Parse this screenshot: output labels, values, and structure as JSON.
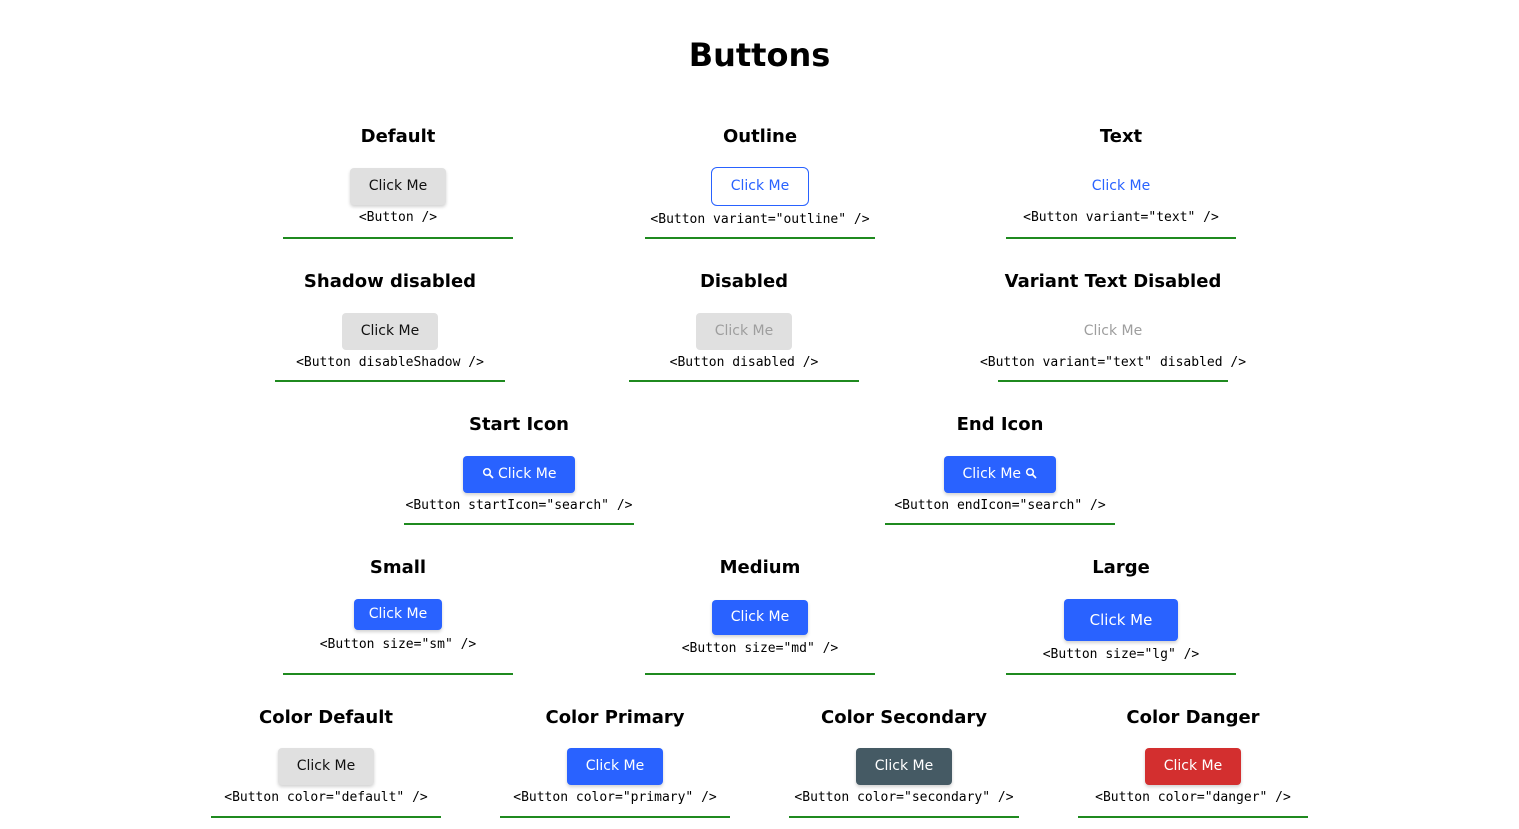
{
  "page": {
    "title": "Buttons"
  },
  "sections": {
    "default": {
      "title": "Default",
      "button_label": "Click Me",
      "code": "<Button />"
    },
    "outline": {
      "title": "Outline",
      "button_label": "Click Me",
      "code": "<Button variant=\"outline\" />"
    },
    "text": {
      "title": "Text",
      "button_label": "Click Me",
      "code": "<Button variant=\"text\" />"
    },
    "shadow_disabled": {
      "title": "Shadow disabled",
      "button_label": "Click Me",
      "code": "<Button disableShadow />"
    },
    "disabled": {
      "title": "Disabled",
      "button_label": "Click Me",
      "code": "<Button disabled />"
    },
    "variant_text_disabled": {
      "title": "Variant Text Disabled",
      "button_label": "Click Me",
      "code": "<Button variant=\"text\" disabled />"
    },
    "start_icon": {
      "title": "Start Icon",
      "button_label": "Click Me",
      "icon": "search-icon",
      "code": "<Button startIcon=\"search\" />"
    },
    "end_icon": {
      "title": "End Icon",
      "button_label": "Click Me",
      "icon": "search-icon",
      "code": "<Button endIcon=\"search\" />"
    },
    "small": {
      "title": "Small",
      "button_label": "Click Me",
      "code": "<Button size=\"sm\" />"
    },
    "medium": {
      "title": "Medium",
      "button_label": "Click Me",
      "code": "<Button size=\"md\" />"
    },
    "large": {
      "title": "Large",
      "button_label": "Click Me",
      "code": "<Button size=\"lg\" />"
    },
    "color_default": {
      "title": "Color Default",
      "button_label": "Click Me",
      "code": "<Button color=\"default\" />"
    },
    "color_primary": {
      "title": "Color Primary",
      "button_label": "Click Me",
      "code": "<Button color=\"primary\" />"
    },
    "color_secondary": {
      "title": "Color Secondary",
      "button_label": "Click Me",
      "code": "<Button color=\"secondary\" />"
    },
    "color_danger": {
      "title": "Color Danger",
      "button_label": "Click Me",
      "code": "<Button color=\"danger\" />"
    }
  },
  "colors": {
    "default": "#e0e0e0",
    "primary": "#2962ff",
    "secondary": "#455a64",
    "danger": "#d32f2f",
    "disabled_text": "#9e9e9e",
    "divider": "#1f8a1f"
  }
}
